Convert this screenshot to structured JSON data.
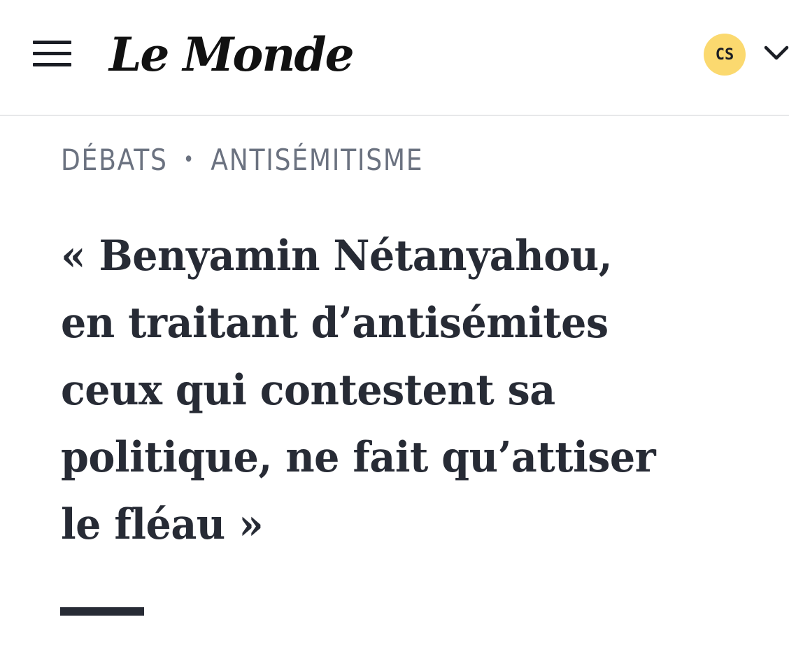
{
  "header": {
    "logo_text": "Le Monde",
    "user_initials": "CS"
  },
  "breadcrumb": {
    "section": "DÉBATS",
    "separator": "•",
    "topic": "ANTISÉMITISME"
  },
  "article": {
    "title": "« Benyamin Nétanyahou,\nen traitant d’antisémites\nceux qui contestent sa\npolitique, ne fait qu’attiser\nle fléau »"
  },
  "icons": {
    "menu": "hamburger-menu-icon",
    "account_dropdown": "chevron-down-icon"
  },
  "colors": {
    "avatar_background": "#fbd96f",
    "headline": "#272b35",
    "breadcrumb": "#6b7280"
  }
}
